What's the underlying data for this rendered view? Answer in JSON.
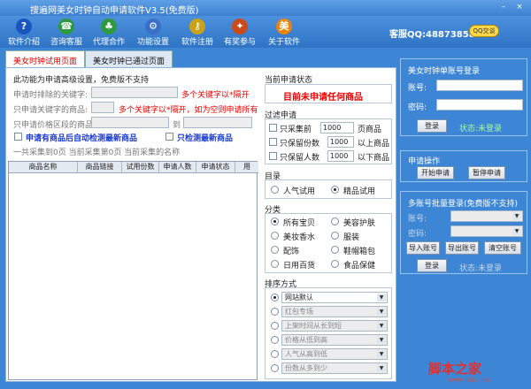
{
  "window": {
    "title": "搜遍网美女时钟自动申请软件V3.5(免费版)",
    "min": "–",
    "close": "×"
  },
  "toolbar": [
    {
      "label": "软件介绍",
      "icon": "question-icon",
      "color": "#1a56c0",
      "glyph": "?"
    },
    {
      "label": "咨询客服",
      "icon": "customer-service-icon",
      "color": "#2d9a3f",
      "glyph": "☎"
    },
    {
      "label": "代理合作",
      "icon": "team-icon",
      "color": "#2d9a3f",
      "glyph": "♣"
    },
    {
      "label": "功能设置",
      "icon": "settings-icon",
      "color": "#3a6ec9",
      "glyph": "⚙"
    },
    {
      "label": "软件注册",
      "icon": "key-icon",
      "color": "#c9a21a",
      "glyph": "⚷"
    },
    {
      "label": "有奖参与",
      "icon": "gift-icon",
      "color": "#c94a1a",
      "glyph": "✦"
    },
    {
      "label": "关于软件",
      "icon": "beauty-logo-icon",
      "color": "#e8830c",
      "glyph": "美"
    }
  ],
  "qq": {
    "text": "客服QQ:488738580",
    "badge": "QQ交谈"
  },
  "tabs": [
    "美女时钟试用页面",
    "美女时钟已通过页面"
  ],
  "adv": {
    "title": "此功能为申请高级设置，免费版不支持",
    "exclude_label": "申请时排除的关键字:",
    "exclude_hint": "多个关键字以*隔开",
    "only_label": "只申请关键字的商品:",
    "only_hint": "多个关键字以*隔开，如为空则申请所有",
    "price_label": "只申请价格区段的商品:",
    "price_to": "到",
    "auto_detect": "申请有商品后自动检测最新商品",
    "only_detect": "只检测最新商品",
    "stats": "一共采集到0页 当前采集第0页 当前采集的名称"
  },
  "grid": {
    "columns": [
      "商品名称",
      "商品链接",
      "试用份数",
      "申请人数",
      "申请状态",
      "用"
    ]
  },
  "status": {
    "title": "当前申请状态",
    "text": "目前未申请任何商品"
  },
  "filter": {
    "title": "过滤申请",
    "rows": [
      {
        "label": "只采集前",
        "value": "1000",
        "suffix": "页商品"
      },
      {
        "label": "只保留份数",
        "value": "1000",
        "suffix": "以上商品"
      },
      {
        "label": "只保留人数",
        "value": "1000",
        "suffix": "以下商品"
      }
    ]
  },
  "category": {
    "title": "目录",
    "options": [
      "人气试用",
      "精品试用"
    ],
    "selected": 1
  },
  "classify": {
    "title": "分类",
    "options": [
      "所有宝贝",
      "美容护肤",
      "美妆香水",
      "服装",
      "配饰",
      "鞋帽箱包",
      "日用百货",
      "食品保健"
    ],
    "selected": 0
  },
  "sort": {
    "title": "排序方式",
    "options": [
      "网站默认",
      "红包专场",
      "上架时间从长到短",
      "价格从低到高",
      "人气从高到低",
      "份数从多到少"
    ],
    "selected": 0
  },
  "login": {
    "title": "美女时钟单账号登录",
    "account_label": "账号:",
    "password_label": "密码:",
    "button": "登录",
    "status": "状态:未登录"
  },
  "ops": {
    "title": "申请操作",
    "start": "开始申请",
    "pause": "暂停申请"
  },
  "multi": {
    "title": "多账号批量登录(免费版不支持)",
    "account_label": "账号:",
    "password_label": "密码:",
    "import": "导入账号",
    "export": "导出账号",
    "clear": "清空账号",
    "button": "登录",
    "status": "状态:未登录"
  },
  "watermark": {
    "text": "脚本之家",
    "url": "www.jb51.net"
  }
}
